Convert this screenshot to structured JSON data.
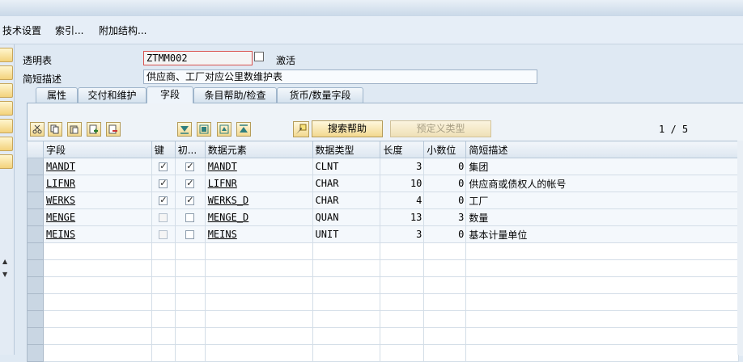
{
  "menu": [
    "技术设置",
    "索引...",
    "附加结构..."
  ],
  "header": {
    "table_label": "透明表",
    "table_value": "ZTMM002",
    "status": "激活",
    "desc_label": "简短描述",
    "desc_value": "供应商、工厂对应公里数维护表"
  },
  "tabs": [
    "属性",
    "交付和维护",
    "字段",
    "条目帮助/检查",
    "货币/数量字段"
  ],
  "active_tab": "字段",
  "toolbar": {
    "search_help": "搜索帮助",
    "predefined_type": "预定义类型",
    "page_indicator": "1 / 5"
  },
  "columns": [
    "字段",
    "键",
    "初...",
    "数据元素",
    "数据类型",
    "长度",
    "小数位",
    "简短描述"
  ],
  "rows": [
    {
      "field": "MANDT",
      "key": true,
      "init": true,
      "element": "MANDT",
      "type": "CLNT",
      "length": "3",
      "decimals": "0",
      "desc": "集团"
    },
    {
      "field": "LIFNR",
      "key": true,
      "init": true,
      "element": "LIFNR",
      "type": "CHAR",
      "length": "10",
      "decimals": "0",
      "desc": "供应商或债权人的帐号"
    },
    {
      "field": "WERKS",
      "key": true,
      "init": true,
      "element": "WERKS_D",
      "type": "CHAR",
      "length": "4",
      "decimals": "0",
      "desc": "工厂"
    },
    {
      "field": "MENGE",
      "key": false,
      "init": false,
      "element": "MENGE_D",
      "type": "QUAN",
      "length": "13",
      "decimals": "3",
      "desc": "数量"
    },
    {
      "field": "MEINS",
      "key": false,
      "init": false,
      "element": "MEINS",
      "type": "UNIT",
      "length": "3",
      "decimals": "0",
      "desc": "基本计量单位"
    }
  ],
  "empty_rows": 7,
  "icons": [
    "cut-icon",
    "copy-icon",
    "paste-icon",
    "insert-row-icon",
    "delete-row-icon",
    "scroll-down-icon",
    "scroll-first-icon",
    "scroll-last-icon",
    "scroll-up-icon",
    "data-element-icon"
  ]
}
